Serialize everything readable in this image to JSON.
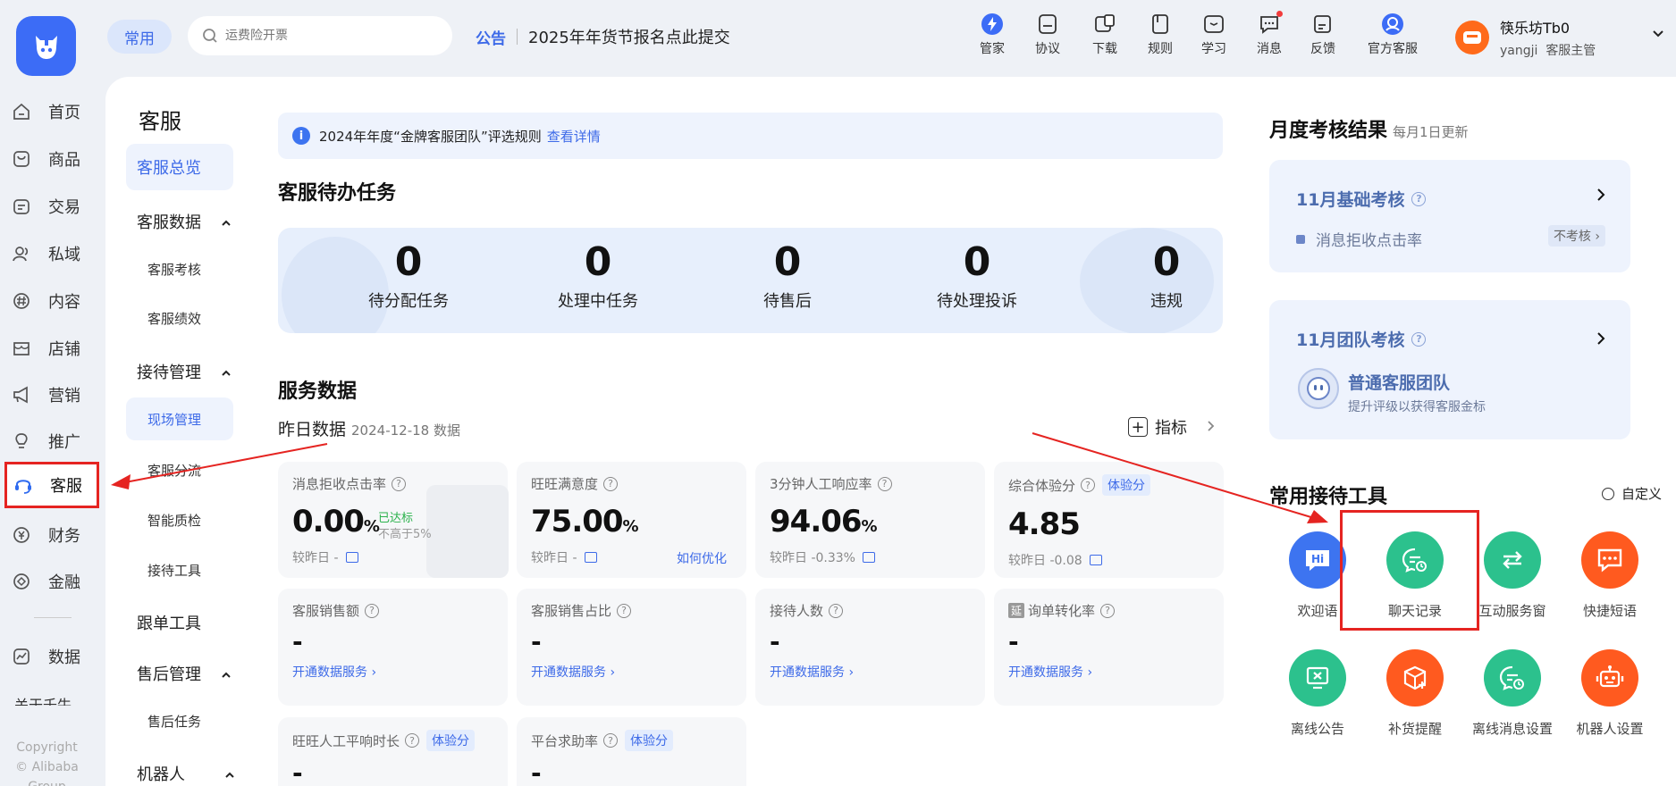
{
  "topbar": {
    "common_label": "常用",
    "search_placeholder": "运费险开票",
    "notice_tag": "公告",
    "notice_text": "2025年年货节报名点此提交",
    "nav": [
      {
        "label": "管家",
        "icon": "lightning-icon"
      },
      {
        "label": "协议",
        "icon": "document-icon"
      },
      {
        "label": "下载",
        "icon": "download-icon"
      },
      {
        "label": "规则",
        "icon": "rules-icon"
      },
      {
        "label": "学习",
        "icon": "study-icon"
      },
      {
        "label": "消息",
        "icon": "message-icon"
      },
      {
        "label": "反馈",
        "icon": "feedback-icon"
      },
      {
        "label": "官方客服",
        "icon": "service-icon"
      }
    ],
    "user_name": "筷乐坊Tb0",
    "user_account": "yangji",
    "user_role": "客服主管"
  },
  "sidebar": {
    "items": [
      {
        "label": "首页",
        "icon": "home-icon"
      },
      {
        "label": "商品",
        "icon": "goods-icon"
      },
      {
        "label": "交易",
        "icon": "trade-icon"
      },
      {
        "label": "私域",
        "icon": "users-icon"
      },
      {
        "label": "内容",
        "icon": "content-icon"
      },
      {
        "label": "店铺",
        "icon": "shop-icon"
      },
      {
        "label": "营销",
        "icon": "megaphone-icon"
      },
      {
        "label": "推广",
        "icon": "bulb-icon"
      },
      {
        "label": "客服",
        "icon": "headset-icon"
      },
      {
        "label": "财务",
        "icon": "yen-icon"
      },
      {
        "label": "金融",
        "icon": "finance-icon"
      },
      {
        "label": "数据",
        "icon": "chart-icon"
      }
    ],
    "about": "关于千牛",
    "copyright1": "Copyright",
    "copyright2": "© Alibaba",
    "copyright3": "Group"
  },
  "subnav": {
    "title": "客服",
    "overview": "客服总览",
    "group1": "客服数据",
    "g1_items": [
      "客服考核",
      "客服绩效"
    ],
    "group2": "接待管理",
    "g2_items": [
      "现场管理",
      "客服分流",
      "智能质检",
      "接待工具"
    ],
    "track": "跟单工具",
    "group3": "售后管理",
    "g3_items": [
      "售后任务"
    ],
    "group4": "机器人"
  },
  "banner": {
    "text": "2024年年度“金牌客服团队”评选规则",
    "link": "查看详情"
  },
  "todo": {
    "title": "客服待办任务",
    "items": [
      {
        "value": "0",
        "label": "待分配任务"
      },
      {
        "value": "0",
        "label": "处理中任务"
      },
      {
        "value": "0",
        "label": "待售后"
      },
      {
        "value": "0",
        "label": "待处理投诉"
      },
      {
        "value": "0",
        "label": "违规"
      }
    ]
  },
  "service": {
    "title": "服务数据",
    "yesterday": "昨日数据",
    "date": "2024-12-18 数据",
    "metric_btn": "指标",
    "cards": [
      {
        "title": "消息拒收点击率",
        "value": "0.00",
        "unit": "%",
        "compare": "较昨日 -",
        "status": "已达标",
        "threshold": "不高于5%"
      },
      {
        "title": "旺旺满意度",
        "value": "75.00",
        "unit": "%",
        "compare": "较昨日 -",
        "link": "如何优化"
      },
      {
        "title": "3分钟人工响应率",
        "value": "94.06",
        "unit": "%",
        "compare": "较昨日 -0.33%"
      },
      {
        "title": "综合体验分",
        "badge": "体验分",
        "value": "4.85",
        "unit": "",
        "compare": "较昨日 -0.08"
      },
      {
        "title": "客服销售额",
        "value": "-",
        "link": "开通数据服务"
      },
      {
        "title": "客服销售占比",
        "value": "-",
        "link": "开通数据服务"
      },
      {
        "title": "接待人数",
        "value": "-",
        "link": "开通数据服务"
      },
      {
        "title": "询单转化率",
        "prefix": "延",
        "value": "-",
        "link": "开通数据服务"
      },
      {
        "title": "旺旺人工平响时长",
        "badge": "体验分",
        "value": "-"
      },
      {
        "title": "平台求助率",
        "badge": "体验分",
        "value": "-"
      }
    ]
  },
  "monthly": {
    "title": "月度考核结果",
    "subtitle": "每月1日更新",
    "basic_title": "11月基础考核",
    "basic_item": "消息拒收点击率",
    "basic_tag": "不考核",
    "team_title": "11月团队考核",
    "team_name": "普通客服团队",
    "team_desc": "提升评级以获得客服金标"
  },
  "tools": {
    "title": "常用接待工具",
    "custom": "自定义",
    "items": [
      {
        "label": "欢迎语",
        "color": "#3d74f0",
        "icon": "hi-icon"
      },
      {
        "label": "聊天记录",
        "color": "#2cc18d",
        "icon": "chat-history-icon"
      },
      {
        "label": "互动服务窗",
        "color": "#2cc18d",
        "icon": "swap-icon"
      },
      {
        "label": "快捷短语",
        "color": "#ff5a1f",
        "icon": "quick-phrase-icon"
      },
      {
        "label": "离线公告",
        "color": "#2cc18d",
        "icon": "offline-notice-icon"
      },
      {
        "label": "补货提醒",
        "color": "#ff5a1f",
        "icon": "restock-icon"
      },
      {
        "label": "离线消息设置",
        "color": "#2cc18d",
        "icon": "offline-message-icon"
      },
      {
        "label": "机器人设置",
        "color": "#ff5a1f",
        "icon": "robot-icon"
      }
    ]
  },
  "colors": {
    "accent": "#3d6ae8",
    "annotation": "#e52421"
  }
}
